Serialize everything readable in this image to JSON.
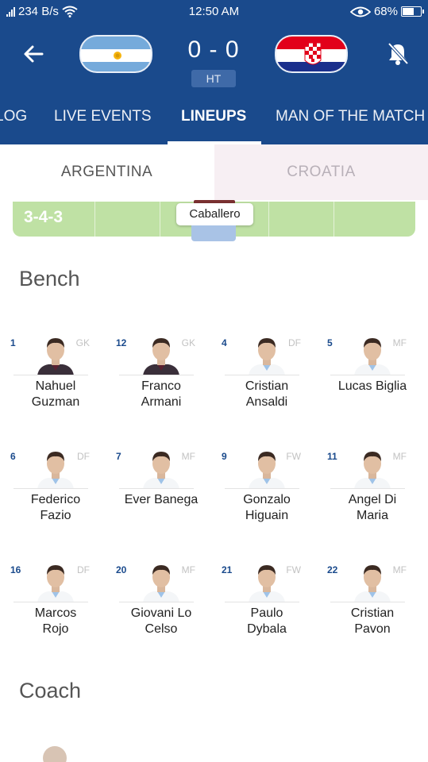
{
  "statusbar": {
    "net_speed": "234 B/s",
    "time": "12:50 AM",
    "battery": "68%",
    "battery_level": 0.68,
    "icons": [
      "signal-icon",
      "wifi-icon",
      "eye-icon",
      "battery-icon"
    ]
  },
  "match": {
    "score": "0 - 0",
    "period": "HT",
    "home_flag": "argentina-flag",
    "away_flag": "croatia-flag"
  },
  "tabs": [
    "LOG",
    "LIVE EVENTS",
    "LINEUPS",
    "MAN OF THE MATCH"
  ],
  "active_tab": "LINEUPS",
  "teams": {
    "left": "ARGENTINA",
    "right": "CROATIA",
    "selected": "ARGENTINA"
  },
  "pitch": {
    "formation": "3-4-3",
    "visible_player": "Caballero"
  },
  "bench_title": "Bench",
  "coach_title": "Coach",
  "bench": [
    {
      "number": "1",
      "position": "GK",
      "first": "Nahuel",
      "last": "Guzman",
      "kit": "gk"
    },
    {
      "number": "12",
      "position": "GK",
      "first": "Franco",
      "last": "Armani",
      "kit": "gk"
    },
    {
      "number": "4",
      "position": "DF",
      "first": "Cristian",
      "last": "Ansaldi",
      "kit": "field"
    },
    {
      "number": "5",
      "position": "MF",
      "first": "Lucas Biglia",
      "last": "",
      "kit": "field"
    },
    {
      "number": "6",
      "position": "DF",
      "first": "Federico",
      "last": "Fazio",
      "kit": "field"
    },
    {
      "number": "7",
      "position": "MF",
      "first": "Ever Banega",
      "last": "",
      "kit": "field"
    },
    {
      "number": "9",
      "position": "FW",
      "first": "Gonzalo",
      "last": "Higuain",
      "kit": "field"
    },
    {
      "number": "11",
      "position": "MF",
      "first": "Angel Di",
      "last": "Maria",
      "kit": "field"
    },
    {
      "number": "16",
      "position": "DF",
      "first": "Marcos",
      "last": "Rojo",
      "kit": "field"
    },
    {
      "number": "20",
      "position": "MF",
      "first": "Giovani Lo",
      "last": "Celso",
      "kit": "field"
    },
    {
      "number": "21",
      "position": "FW",
      "first": "Paulo",
      "last": "Dybala",
      "kit": "field"
    },
    {
      "number": "22",
      "position": "MF",
      "first": "Cristian",
      "last": "Pavon",
      "kit": "field"
    }
  ],
  "colors": {
    "header": "#1a4a8c",
    "pitch": "#bfe1a4",
    "number": "#1a4a8c",
    "position": "#c2c2c2",
    "inactive_team_bg": "#f7eff3"
  }
}
